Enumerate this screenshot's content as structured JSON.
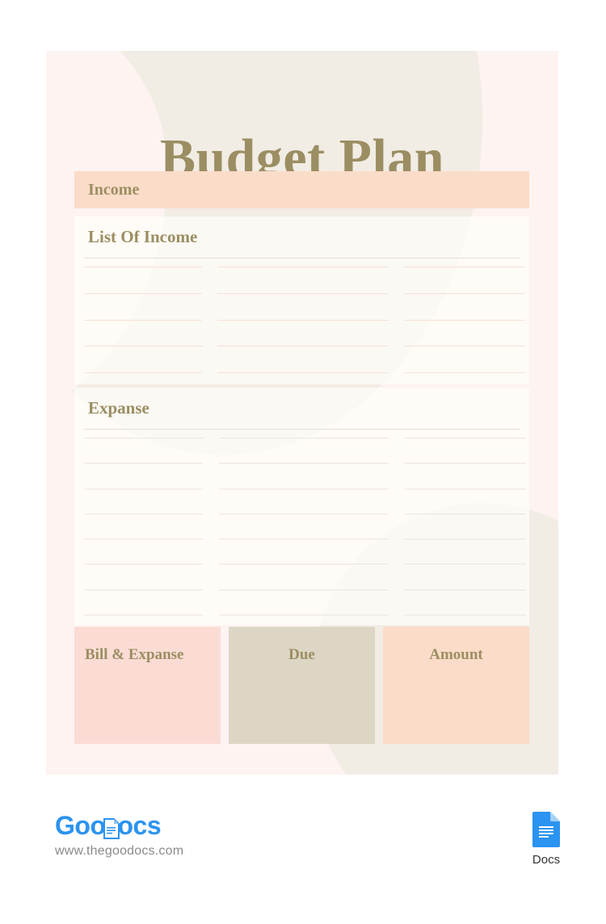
{
  "document": {
    "title": "Budget Plan",
    "accent_gold": "#9b8e62",
    "card_background": "#fdf3f1",
    "blob_color": "#f1ece4"
  },
  "income_bar": {
    "label": "Income",
    "background": "#fbdcc8"
  },
  "income_section": {
    "title": "List Of Income",
    "rule_color": "#e8ded0",
    "line_color": "#f7e0d4",
    "columns": 3,
    "rows_per_column": 5
  },
  "expanse_section": {
    "title": "Expanse",
    "rule_color": "#e8ded0",
    "line_color": "#ece5dc",
    "columns": 3,
    "rows_per_column": 8
  },
  "bottom_boxes": [
    {
      "label": "Bill & Expanse",
      "background": "#fbdcd5",
      "align": "align-left"
    },
    {
      "label": "Due",
      "background": "#ddd6c5",
      "align": "align-center"
    },
    {
      "label": "Amount",
      "background": "#fbdcc8",
      "align": "align-center"
    }
  ],
  "footer": {
    "brand_part1": "Goo",
    "brand_part2": "ocs",
    "url": "www.thegoodocs.com",
    "docs_label": "Docs",
    "brand_color": "#2b93f0",
    "url_color": "#8a8a8a"
  }
}
